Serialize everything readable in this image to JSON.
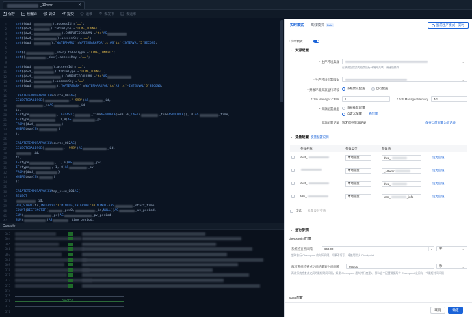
{
  "window": {
    "tab_name": "_10wmr",
    "close": "✕"
  },
  "toolbar": {
    "items": [
      {
        "label": "保存",
        "icon": "save-icon",
        "enabled": true
      },
      {
        "label": "预编译",
        "icon": "precompile-icon",
        "enabled": true
      },
      {
        "label": "调试",
        "icon": "debug-icon",
        "enabled": true
      },
      {
        "label": "提交",
        "icon": "submit-icon",
        "enabled": true
      },
      {
        "label": "运维",
        "icon": "ops-icon",
        "enabled": false
      },
      {
        "label": "去发布",
        "icon": "publish-icon",
        "enabled": false
      },
      {
        "label": "去运维",
        "icon": "goto-ops-icon",
        "enabled": false
      }
    ]
  },
  "editor": {
    "lines": [
      {
        "n": "1",
        "t": "set ${dwd_ ……).accessId = '……';"
      },
      {
        "n": "2",
        "t": "set ${dwd_ ……).tableType = 'TIME_TUNNEL';"
      },
      {
        "n": "3",
        "t": "set ${dwd_ ……).COMPUTEDCOLUMN = 'ts' AS ……"
      },
      {
        "n": "4",
        "t": "set ${dwd_ ……).accessKey = '……';"
      },
      {
        "n": "5",
        "t": "set ${dwd_ ……).\"WATERMARK\" = WATERMARK FOR 'ts' AS 'ts' - INTERVAL '5' SECOND;"
      },
      {
        "n": "6",
        "t": ""
      },
      {
        "n": "7",
        "t": "set ${ …… _bhwr}.tableType = 'TIME_TUNNEL';"
      },
      {
        "n": "8",
        "t": "set ${ …… _bhwr}.accessKey = '……';"
      },
      {
        "n": "9",
        "t": ""
      },
      {
        "n": "10",
        "t": "set ${dwd_ ……).accessId = '……';"
      },
      {
        "n": "11",
        "t": "set ${dwd_ ……).tableType = 'TIME_TUNNEL';"
      },
      {
        "n": "12",
        "t": "set ${dwd_ ……).COMPUTEDCOLUMN = 'ts' AS ……"
      },
      {
        "n": "13",
        "t": "set ${dwd_ ……).accessKey = '……';"
      },
      {
        "n": "14",
        "t": "set ${dwd_ ……).\"WATERMARK\" = WATERMARK FOR 'ts' AS 'ts' - INTERVAL '5' SECOND;"
      },
      {
        "n": "15",
        "t": ""
      },
      {
        "n": "16",
        "t": "CREATE TEMPORARY VIEW source_001 AS ("
      },
      {
        "n": "17",
        "t": "  SELECT COALESCE(…… , '-999') AS …… _id,"
      },
      {
        "n": "18",
        "t": "         …… _id AS …… _id,"
      },
      {
        "n": "19",
        "t": "         ts,"
      },
      {
        "n": "20",
        "t": "         IF(type ……, IF(CAST(…… _time AS DOUBLE)>30,30,CAST(…… _time AS DOUBLE)), 0) AS …… _time,"
      },
      {
        "n": "21",
        "t": "         IF(type ……, 1,0) AS …… _pv"
      },
      {
        "n": "22",
        "t": "  FROM ${dwd_ …… }"
      },
      {
        "n": "23",
        "t": "  WHERE type IN ( …… )"
      },
      {
        "n": "24",
        "t": ");"
      },
      {
        "n": "25",
        "t": ""
      },
      {
        "n": "26",
        "t": "CREATE TEMPORARY VIEW source_002 AS ("
      },
      {
        "n": "27",
        "t": "  SELECT COALESCE(…… , '-999') AS …… _id,"
      },
      {
        "n": "28",
        "t": "         …… _id,"
      },
      {
        "n": "29",
        "t": "         ts,"
      },
      {
        "n": "30",
        "t": "         IF(type ……, 1, 0) AS …… _pv,"
      },
      {
        "n": "31",
        "t": "         IF(type ……, 1, 0) AS …… _pv"
      },
      {
        "n": "32",
        "t": "  FROM ${dwd_ …… }"
      },
      {
        "n": "33",
        "t": "  WHERE type IN ( …… )"
      },
      {
        "n": "34",
        "t": ");"
      },
      {
        "n": "35",
        "t": ""
      },
      {
        "n": "36",
        "t": "CREATE TEMPORARY VIEW tmp_view_001 AS ("
      },
      {
        "n": "37",
        "t": "  SELECT"
      },
      {
        "n": "38",
        "t": "    …… _id,"
      },
      {
        "n": "39",
        "t": "    HOP_START(ts, INTERVAL '1' MINUTE, INTERVAL '10' MINUTE) AS …… _start_time,"
      },
      {
        "n": "40",
        "t": "    COUNT(DISTINCT IF(…… _pv>0, …… _id, NULL)) AS …… _uv_period,"
      },
      {
        "n": "41",
        "t": "    SUM(…… _pv) AS …… _pv_period,"
      },
      {
        "n": "42",
        "t": "    SUM(…… ) AS …… _time_period,"
      }
    ]
  },
  "console": {
    "title": "Console",
    "line_numbers": [
      "363",
      "364",
      "365",
      "366",
      "367",
      "368",
      "369",
      "370",
      "371",
      "372",
      "373",
      "374",
      "375",
      "376",
      "377",
      "378"
    ],
    "success_text": "SUCCESS"
  },
  "panel": {
    "tabs": [
      {
        "label": "实时模式",
        "active": true
      },
      {
        "label": "离线模式",
        "active": false
      },
      {
        "label": "Beta",
        "active": false
      }
    ],
    "env_button": "当前生产模式：实时",
    "realtime_mode_label": "* 实时模式",
    "resource_section": "资源配置",
    "prod_cluster_label": "* 生产环境集群",
    "prod_cluster_hint": "已映射至提交的任务执行环境所关联，请谨慎操作",
    "prod_queue_label": "* 生产环境引擎版本",
    "dev_prod_label": "* 开发环境资源运行环境",
    "dev_prod_options": [
      "系统默认配置",
      "自行配置"
    ],
    "jm_cpu_label": "* Job Manager CPUs",
    "jm_cpu_value": "1",
    "jm_mem_label": "* Job Manager Memory",
    "jm_mem_value": "4Gi",
    "res_type_label": "* 资源配置类型",
    "res_type_options": [
      "系统推荐配置",
      "自定义配置"
    ],
    "res_link": "去配置",
    "res_record_label": "资源配置记录",
    "res_record_value": "暂无保存资源记录",
    "res_record_link": "保存当前配置为新记录",
    "var_section": "变量配置",
    "var_link": "变量配置说明",
    "var_headers": [
      "参数名称",
      "参数类型",
      "参数值"
    ],
    "var_rows": [
      {
        "name": "dwd_",
        "type": "本地变量",
        "value": "dwd_",
        "action": "设为空值"
      },
      {
        "name": "",
        "type": "本地变量",
        "value": "_10wmr",
        "action": "设为空值"
      },
      {
        "name": "dwd_",
        "type": "本地变量",
        "value": "dwd_",
        "action": "设为空值"
      },
      {
        "name": "tdm_",
        "type": "本地变量",
        "value": "tdm_ _info",
        "action": "设为空值"
      }
    ],
    "select_all": "全选",
    "batch_empty": "批量设为空值",
    "run_section": "运行参数",
    "checkpoint_title": "checkpoint配置",
    "cp_interval_label": "系统检查点间隔",
    "cp_interval_value": "660.00",
    "cp_interval_unit": "秒",
    "cp_hint": "超时执行 Checkpoint 的时间间隔，如果不填写，将使用默认 Checkpoint",
    "cp_min_label": "两次系统检查点之间的最短时间间隔",
    "cp_min_value": "660.00",
    "cp_min_unit": "秒",
    "cp_min_hint": "两次系统检查点之间的最短时间间隔，如果 Checkpoint 最大并行度是1，那么这个配置确保两个 Checkpoint 之间有一个最短时间间隔",
    "state_title": "State配置",
    "cancel": "取消",
    "ok": "确定"
  },
  "colors": {
    "accent": "#1a63d8",
    "keyword": "#4d8fe8",
    "string": "#d7b24c",
    "success": "#46c15a"
  }
}
